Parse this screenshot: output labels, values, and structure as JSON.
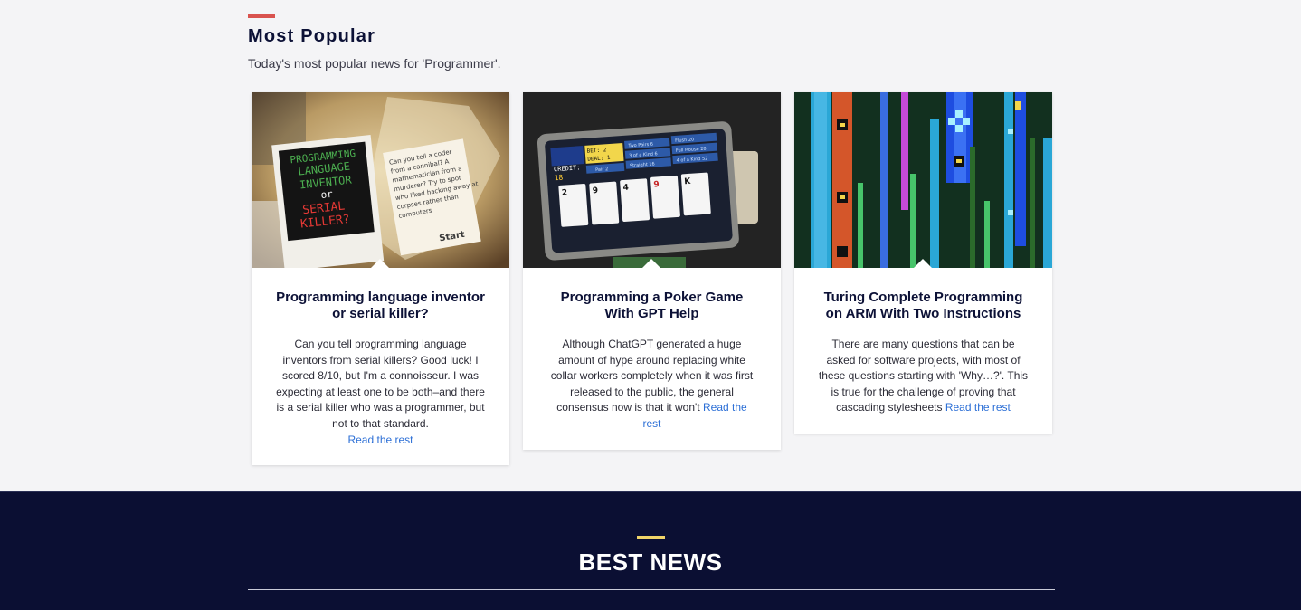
{
  "popular": {
    "title": "Most Popular",
    "subtitle": "Today's most popular news for 'Programmer'.",
    "accent_color": "#d9534f",
    "cards": [
      {
        "title": "Programming language inventor or serial killer?",
        "excerpt": "Can you tell programming language inventors from serial killers? Good luck! I scored 8/10, but I'm a connoisseur. I was expecting at least one to be both–and there is a serial killer who was a programmer, but not to that standard.",
        "read_more": "Read the rest",
        "image": {
          "headline_lines": [
            "PROGRAMMING",
            "LANGUAGE",
            "INVENTOR",
            "or",
            "SERIAL",
            "KILLER?"
          ],
          "note_lines": [
            "Can you tell a coder",
            "from a cannibal? A",
            "mathematician from a",
            "murderer? Try to spot",
            "who liked hacking away at",
            "corpses rather than",
            "computers"
          ],
          "start_label": "Start"
        }
      },
      {
        "title": "Programming a Poker Game With GPT Help",
        "excerpt": "Although ChatGPT generated a huge amount of hype around replacing white collar workers completely when it was first released to the public, the general consensus now is that it won't",
        "read_more": "Read the rest",
        "image": {
          "credit_label": "CREDIT:",
          "credit_value": "18",
          "bet_label": "BET: 2",
          "deal_label": "DEAL: 1",
          "hands": [
            "Two Pairs 6",
            "Flush 20",
            "3 of a Kind 6",
            "Full House 28",
            "Pair 2",
            "Straight 16",
            "4 of a Kind 52"
          ],
          "cards": [
            "2",
            "9",
            "4",
            "9",
            "K"
          ]
        }
      },
      {
        "title": "Turing Complete Programming on ARM With Two Instructions",
        "excerpt": "There are many questions that can be asked for software projects, with most of these questions starting with 'Why…?'. This is true for the challenge of proving that cascading stylesheets",
        "read_more": "Read the rest",
        "image": {}
      }
    ]
  },
  "best_news": {
    "heading": "BEST NEWS",
    "accent_color": "#f0d469",
    "background": "#0b0f33"
  }
}
